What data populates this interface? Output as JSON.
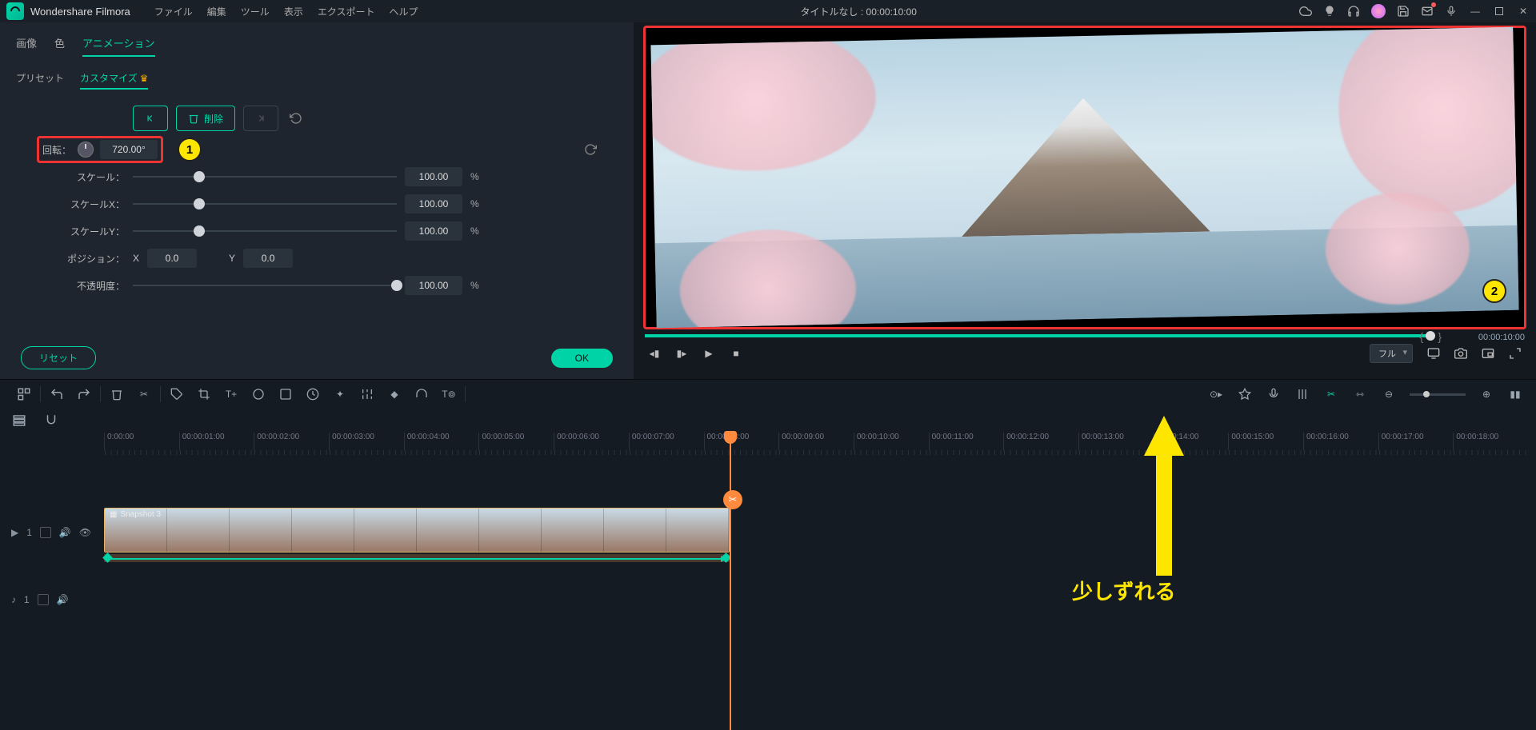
{
  "app": {
    "name": "Wondershare Filmora",
    "title_center": "タイトルなし : 00:00:10:00"
  },
  "menu": [
    "ファイル",
    "編集",
    "ツール",
    "表示",
    "エクスポート",
    "ヘルプ"
  ],
  "tabs1": {
    "items": [
      "画像",
      "色",
      "アニメーション"
    ],
    "active": 2
  },
  "tabs2": {
    "items": [
      "プリセット",
      "カスタマイズ"
    ],
    "active": 1
  },
  "kf": {
    "delete_label": "削除"
  },
  "props": {
    "rotation": {
      "label": "回転：",
      "value": "720.00°"
    },
    "scale": {
      "label": "スケール：",
      "value": "100.00",
      "unit": "%"
    },
    "scalex": {
      "label": "スケールX：",
      "value": "100.00",
      "unit": "%"
    },
    "scaley": {
      "label": "スケールY：",
      "value": "100.00",
      "unit": "%"
    },
    "position": {
      "label": "ポジション：",
      "xlabel": "X",
      "x": "0.0",
      "ylabel": "Y",
      "y": "0.0"
    },
    "opacity": {
      "label": "不透明度：",
      "value": "100.00",
      "unit": "%"
    }
  },
  "buttons": {
    "reset": "リセット",
    "ok": "OK"
  },
  "preview": {
    "quality": "フル",
    "timecode": "00:00:10:00"
  },
  "ruler": [
    "0:00:00",
    "00:00:01:00",
    "00:00:02:00",
    "00:00:03:00",
    "00:00:04:00",
    "00:00:05:00",
    "00:00:06:00",
    "00:00:07:00",
    "00:00:08:00",
    "00:00:09:00",
    "00:00:10:00",
    "00:00:11:00",
    "00:00:12:00",
    "00:00:13:00",
    "00:00:14:00",
    "00:00:15:00",
    "00:00:16:00",
    "00:00:17:00",
    "00:00:18:00"
  ],
  "clip": {
    "name": "Snapshot 3"
  },
  "tracks": {
    "video_row": "1",
    "audio_row": "1"
  },
  "annotations": {
    "badge1": "1",
    "badge2": "2",
    "note": "少しずれる"
  }
}
